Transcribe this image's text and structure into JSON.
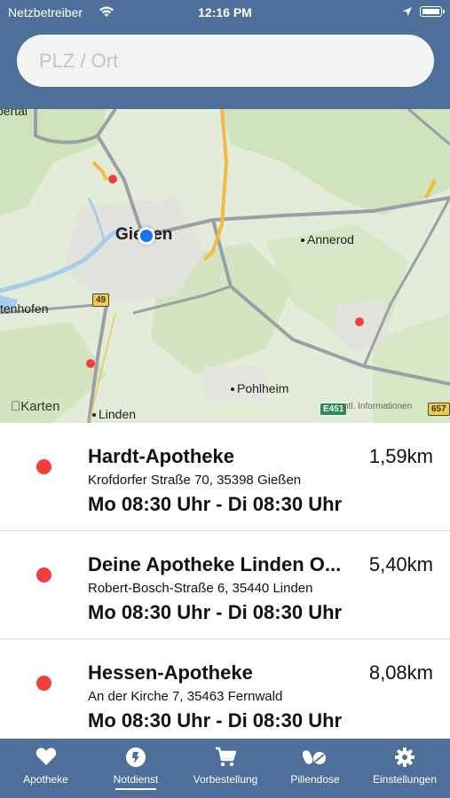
{
  "status_bar": {
    "carrier": "Netzbetreiber",
    "time": "12:16 PM"
  },
  "search": {
    "placeholder": "PLZ / Ort"
  },
  "map": {
    "city_label": "Gießen",
    "labels": {
      "annerod": "Annerod",
      "heuchelheim": "tenhofen",
      "pohlheim": "Pohlheim",
      "linden": "Linden",
      "top_left": "bertal"
    },
    "road_shields": {
      "b49": "49",
      "e451": "E451",
      "a657": "657"
    },
    "attribution": "Karten",
    "legal": "ntl. Informationen"
  },
  "pharmacies": [
    {
      "name": "Hardt-Apotheke",
      "distance": "1,59km",
      "address": "Krofdorfer Straße 70, 35398 Gießen",
      "hours": "Mo 08:30 Uhr - Di 08:30 Uhr"
    },
    {
      "name": "Deine Apotheke Linden O...",
      "distance": "5,40km",
      "address": "Robert-Bosch-Straße  6, 35440 Linden",
      "hours": "Mo 08:30 Uhr - Di 08:30 Uhr"
    },
    {
      "name": "Hessen-Apotheke",
      "distance": "8,08km",
      "address": "An der Kirche 7, 35463 Fernwald",
      "hours": "Mo 08:30 Uhr - Di 08:30 Uhr"
    }
  ],
  "tabbar": {
    "items": [
      {
        "label": "Apotheke",
        "icon": "heart-icon"
      },
      {
        "label": "Notdienst",
        "icon": "notdienst-icon",
        "selected": true
      },
      {
        "label": "Vorbestellung",
        "icon": "cart-icon"
      },
      {
        "label": "Pillendose",
        "icon": "pills-icon"
      },
      {
        "label": "Einstellungen",
        "icon": "gear-icon"
      }
    ]
  },
  "colors": {
    "header": "#4d6f99",
    "marker": "#f23d3d",
    "user_location": "#1a73e8"
  }
}
